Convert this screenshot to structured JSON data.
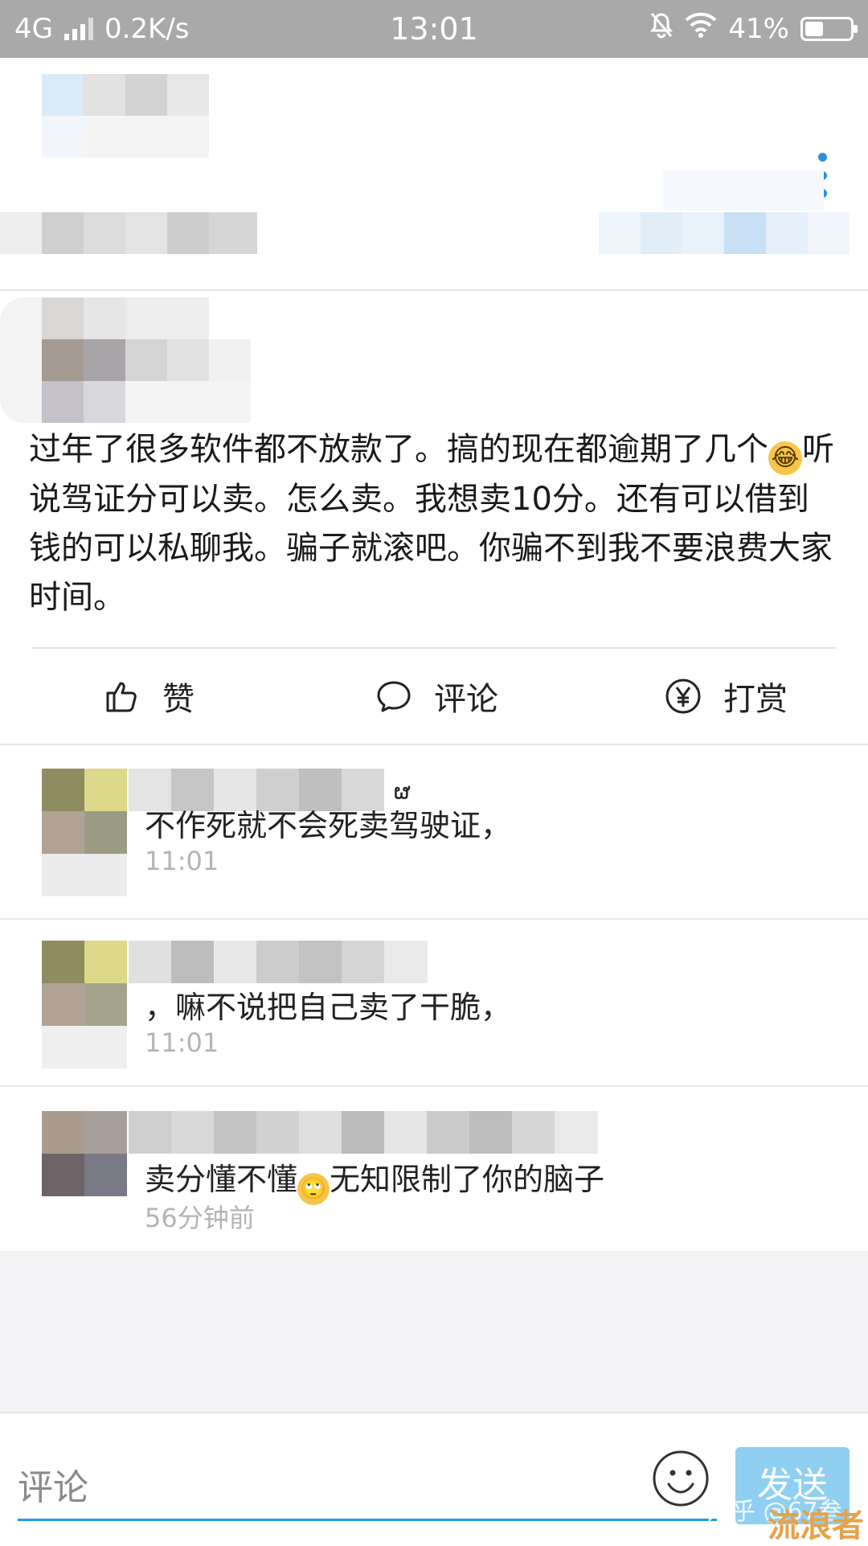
{
  "status_bar": {
    "network": "4G",
    "speed": "0.2K/s",
    "time": "13:01",
    "battery": "41%",
    "battery_level": 0.41
  },
  "header": {
    "more_icon": "more-vertical-icon"
  },
  "post": {
    "text": "过年了很多软件都不放款了。搞的现在都逾期了几个😂听说驾证分可以卖。怎么卖。我想卖10分。还有可以借到钱的可以私聊我。骗子就滚吧。你骗不到我不要浪费大家时间。",
    "text_part1": "过年了很多软件都不放款了。搞的现在都逾期了几个",
    "text_part2": "听说驾证分可以卖。怎么卖。我想卖10分。还有可以借到钱的可以私聊我。骗子就滚吧。你骗不到我不要浪费大家时间。",
    "emoji_glyph": "😂"
  },
  "actions": {
    "like": {
      "label": "赞",
      "icon": "thumbs-up-icon"
    },
    "comment": {
      "label": "评论",
      "icon": "speech-bubble-icon"
    },
    "reward": {
      "label": "打赏",
      "icon": "yen-coin-icon"
    }
  },
  "comments": [
    {
      "name_suffix": "ຜ",
      "text": "不作死就不会死卖驾驶证，",
      "time": "11:01"
    },
    {
      "text": "嘛不说把自己卖了干脆，",
      "text_prefix": "，",
      "time": "11:01"
    },
    {
      "text_before": "卖分懂不懂",
      "emoji": "🙄",
      "text_after": "无知限制了你的脑子",
      "time": "56分钟前"
    }
  ],
  "input": {
    "placeholder": "评论",
    "send_label": "发送",
    "emoji_icon": "smiley-icon"
  },
  "watermark": {
    "text": "知乎 @67叁",
    "brand": "流浪者"
  },
  "colors": {
    "status_bar": "#a9a9a9",
    "accent": "#2f8fe0",
    "send_button": "#8fd0f2",
    "time_text": "#b4b4b4"
  }
}
